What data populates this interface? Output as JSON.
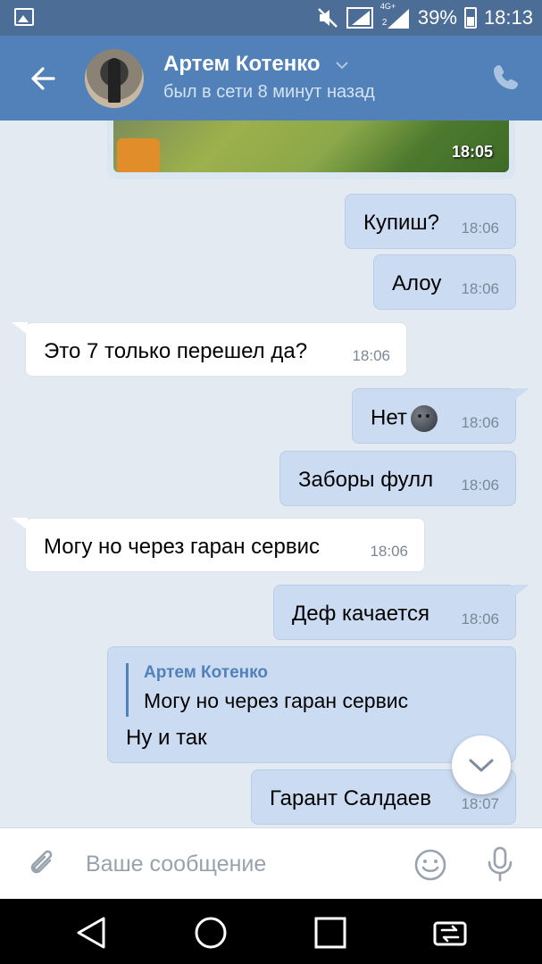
{
  "status_bar": {
    "battery": "39%",
    "time": "18:13",
    "network": "4G+",
    "sim1": "1",
    "sim2": "2",
    "icons": [
      "gallery-icon",
      "mute-icon",
      "sim-signal-icon",
      "signal-icon",
      "battery-icon"
    ]
  },
  "header": {
    "name": "Артем Котенко",
    "status": "был в сети 8 минут назад",
    "icons": [
      "back-arrow-icon",
      "chevron-down-icon",
      "phone-icon"
    ]
  },
  "image_message": {
    "time": "18:05"
  },
  "messages": [
    {
      "dir": "out",
      "text": "Купиш?",
      "time": "18:06"
    },
    {
      "dir": "out",
      "text": "Алоу",
      "time": "18:06"
    },
    {
      "dir": "in",
      "text": "Это 7 только перешел да?",
      "time": "18:06"
    },
    {
      "dir": "out",
      "text": "Нет",
      "emoji": "new-moon-face",
      "time": "18:06"
    },
    {
      "dir": "out",
      "text": "Заборы фулл",
      "time": "18:06"
    },
    {
      "dir": "in",
      "text": "Могу но через гаран сервис",
      "time": "18:06"
    },
    {
      "dir": "out",
      "text": "Деф качается",
      "time": "18:06"
    }
  ],
  "reply_message": {
    "quoted_name": "Артем Котенко",
    "quoted_text": "Могу но через гаран сервис",
    "text": "Ну и так"
  },
  "last_message": {
    "text": "Гарант Салдаев",
    "time": "18:07"
  },
  "composer": {
    "placeholder": "Ваше сообщение",
    "icons": [
      "attach-icon",
      "smile-icon",
      "mic-icon"
    ]
  },
  "navbar": {
    "icons": [
      "back-icon",
      "home-icon",
      "recents-icon",
      "switch-icon"
    ]
  },
  "colors": {
    "header": "#5181b8",
    "status_bar": "#4b6d96",
    "chat_bg": "#e4eaf1",
    "outgoing": "#cbdcf2",
    "incoming": "#ffffff",
    "time": "#7a8797"
  }
}
